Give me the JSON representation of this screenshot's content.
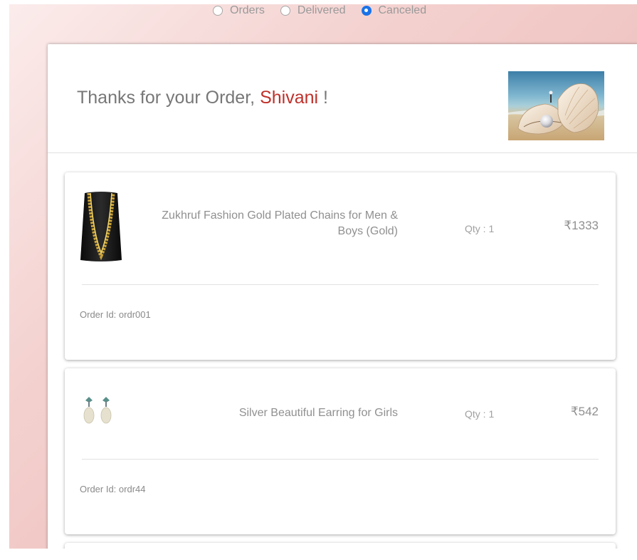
{
  "filters": {
    "options": [
      {
        "label": "Orders",
        "checked": false
      },
      {
        "label": "Delivered",
        "checked": false
      },
      {
        "label": "Canceled",
        "checked": true
      }
    ]
  },
  "header": {
    "greeting_prefix": "Thanks for your Order,",
    "customer_name": "Shivani",
    "greeting_suffix": "!"
  },
  "orders": [
    {
      "product_name": "Zukhruf Fashion Gold Plated Chains for Men & Boys (Gold)",
      "qty": "Qty : 1",
      "price": "₹1333",
      "order_id": "Order Id: ordr001"
    },
    {
      "product_name": "Silver Beautiful Earring for Girls",
      "qty": "Qty : 1",
      "price": "₹542",
      "order_id": "Order Id: ordr44"
    }
  ],
  "colors": {
    "accent_name": "#c0302a",
    "radio_checked": "#1a73e8"
  }
}
